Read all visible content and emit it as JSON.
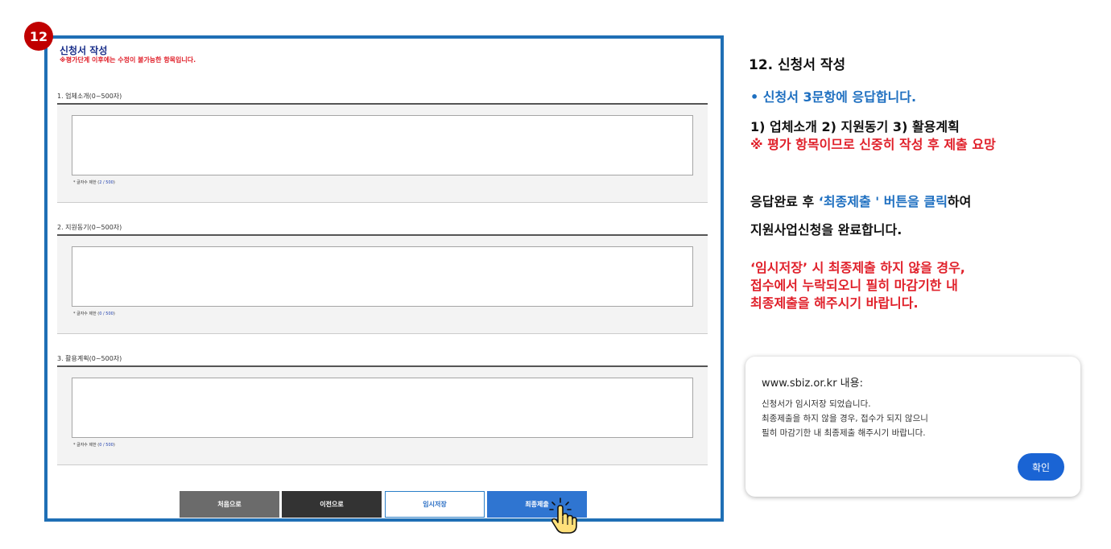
{
  "step_number": "12",
  "form": {
    "title": "신청서 작성",
    "warning": "※평가단계 이후에는 수정이 불가능한 항목입니다.",
    "sections": [
      {
        "label": "1. 업체소개(0~500자)",
        "counter_prefix": "* 글자수 제한 (",
        "counter": "2 / 500",
        "counter_suffix": ")"
      },
      {
        "label": "2. 지원동기(0~500자)",
        "counter_prefix": "* 글자수 제한 (",
        "counter": "0 / 500",
        "counter_suffix": ")"
      },
      {
        "label": "3. 활용계획(0~500자)",
        "counter_prefix": "* 글자수 제한 (",
        "counter": "0 / 500",
        "counter_suffix": ")"
      }
    ],
    "buttons": {
      "first": "처음으로",
      "prev": "이전으로",
      "save": "임시저장",
      "submit": "최종제출"
    }
  },
  "guide": {
    "title": "12. 신청서 작성",
    "bullet": "•  신청서 3문항에 응답합니다.",
    "items": "1)  업체소개  2) 지원동기  3) 활용계획",
    "note": "※ 평가 항목이므로 신중히 작성 후 제출 요망",
    "instr_a": "응답완료 후 ",
    "instr_b": "‘최종제출 ' 버튼을 클릭",
    "instr_c": "하여",
    "instr_line2": "지원사업신청을 완료합니다.",
    "warn_lines": [
      "‘임시저장’ 시 최종제출 하지 않을 경우,",
      "접수에서 누락되오니 필히 마감기한 내",
      "최종제출을 해주시기 바랍니다."
    ]
  },
  "dialog": {
    "title": "www.sbiz.or.kr 내용:",
    "lines": [
      "신청서가 임시저장 되었습니다.",
      "최종제출을 하지 않을 경우, 접수가 되지 않으니",
      "필히 마감기한 내 최종제출 해주시기 바랍니다."
    ],
    "ok": "확인"
  },
  "icons": {
    "cursor": "hand-pointer-click-icon"
  },
  "colors": {
    "frame": "#1f6fb5",
    "accent_red": "#e0202a",
    "accent_blue": "#1e6fc0",
    "submit_button": "#2f75d1"
  }
}
